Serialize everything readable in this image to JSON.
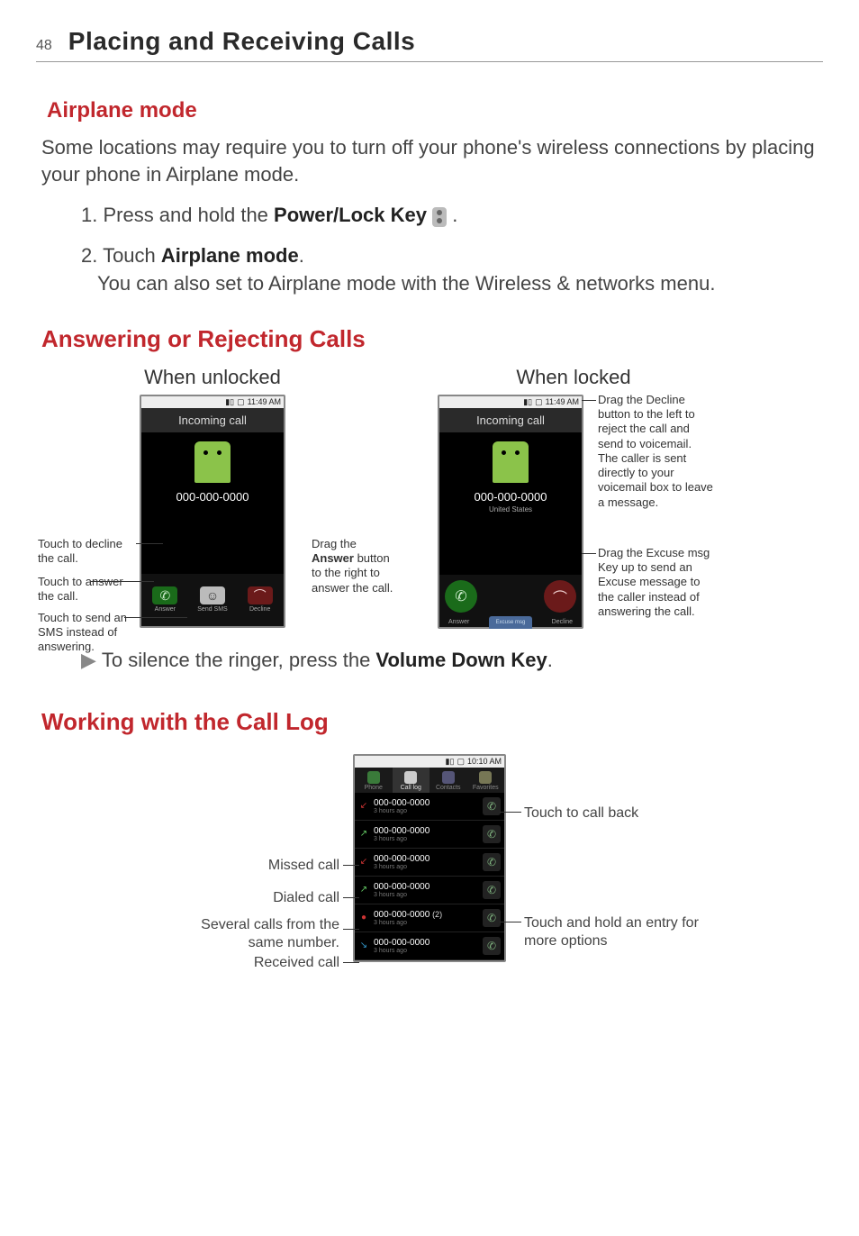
{
  "page_number": "48",
  "chapter_title": "Placing and Receiving Calls",
  "airplane": {
    "heading": "Airplane mode",
    "intro": "Some locations may require you to turn off your phone's wireless connections by placing your phone in Airplane mode.",
    "step1_prefix": "1. Press and hold the ",
    "step1_bold": "Power/Lock Key",
    "step1_suffix": " .",
    "step2_prefix": "2. Touch ",
    "step2_bold": "Airplane mode",
    "step2_suffix": ".",
    "step2_cont": "You can also set to Airplane mode with the Wireless & networks menu."
  },
  "answer_section": {
    "heading": "Answering or Rejecting Calls",
    "unlocked_title": "When unlocked",
    "locked_title": "When locked",
    "status_time": "11:49 AM",
    "incoming": "Incoming call",
    "caller_number": "000-000-0000",
    "caller_loc": "United States",
    "btn_answer": "Answer",
    "btn_sms": "Send SMS",
    "btn_decline": "Decline",
    "excuse_label": "Excuse msg",
    "callouts_unlocked": {
      "decline": "Touch to decline the call.",
      "answer": "Touch to answer the call.",
      "sms": "Touch to send an SMS instead of answering."
    },
    "callout_drag_answer_pre": "Drag the ",
    "callout_drag_answer_bold": "Answer",
    "callout_drag_answer_post": " button to the right to answer the call.",
    "callout_drag_decline": "Drag the Decline button to the left to reject the call and send to voicemail.\nThe caller is sent directly to your voicemail box to leave a message.",
    "callout_excuse": "Drag the Excuse msg Key up to send an Excuse message to the caller instead of answering the call.",
    "silence_pre": "To silence the ringer, press the ",
    "silence_bold": "Volume Down Key",
    "silence_post": "."
  },
  "calllog": {
    "heading": "Working with the Call Log",
    "status_time": "10:10 AM",
    "tabs": [
      "Phone",
      "Call log",
      "Contacts",
      "Favorites"
    ],
    "entries": [
      {
        "type": "missed",
        "number": "000-000-0000",
        "time": "3 hours ago"
      },
      {
        "type": "dialed",
        "number": "000-000-0000",
        "time": "3 hours ago"
      },
      {
        "type": "missed",
        "number": "000-000-0000",
        "time": "3 hours ago"
      },
      {
        "type": "dialed",
        "number": "000-000-0000",
        "time": "3 hours ago"
      },
      {
        "type": "group",
        "number": "000-000-0000",
        "count": "(2)",
        "time": "3 hours ago"
      },
      {
        "type": "received",
        "number": "000-000-0000",
        "time": "3 hours ago"
      }
    ],
    "callouts": {
      "call_back": "Touch to call back",
      "missed": "Missed call",
      "dialed": "Dialed call",
      "group": "Several calls from the same number.",
      "received": "Received call",
      "hold": "Touch and hold an entry for more options"
    }
  }
}
